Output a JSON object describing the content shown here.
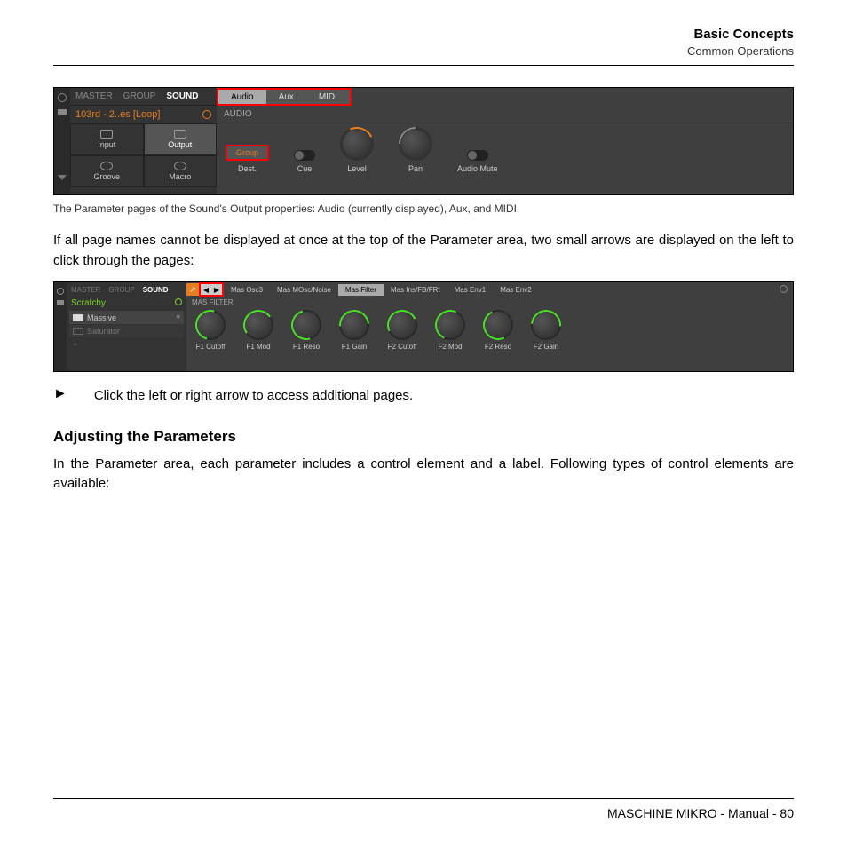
{
  "header": {
    "title": "Basic Concepts",
    "sub": "Common Operations"
  },
  "shot1": {
    "leftTabs": [
      "MASTER",
      "GROUP",
      "SOUND"
    ],
    "soundName": "103rd - 2..es [Loop]",
    "btns": {
      "input": "Input",
      "output": "Output",
      "groove": "Groove",
      "macro": "Macro"
    },
    "pageTabs": [
      "Audio",
      "Aux",
      "MIDI"
    ],
    "audioHeader": "AUDIO",
    "params": {
      "dest": "Dest.",
      "group": "Group",
      "cue": "Cue",
      "level": "Level",
      "pan": "Pan",
      "mute": "Audio Mute"
    }
  },
  "caption1": "The Parameter pages of the Sound's Output properties: Audio (currently displayed), Aux, and MIDI.",
  "para1": "If all page names cannot be displayed at once at the top of the Parameter area, two small arrows are displayed on the left to click through the pages:",
  "shot2": {
    "leftTabs": [
      "MASTER",
      "GROUP",
      "SOUND"
    ],
    "soundName": "Scratchy",
    "items": [
      "Massive",
      "Saturator",
      "+"
    ],
    "pageTabs": [
      "Mas Osc3",
      "Mas MOsc/Noise",
      "Mas Filter",
      "Mas Ins/FB/FRt",
      "Mas Env1",
      "Mas Env2"
    ],
    "sectionHeader": "MAS FILTER",
    "knobs": [
      "F1 Cutoff",
      "F1 Mod",
      "F1 Reso",
      "F1 Gain",
      "F2 Cutoff",
      "F2 Mod",
      "F2 Reso",
      "F2 Gain"
    ]
  },
  "instruct": "Click the left or right arrow to access additional pages.",
  "section": "Adjusting the Parameters",
  "para2": "In the Parameter area, each parameter includes a control element and a label. Following types of control elements are available:",
  "footer": "MASCHINE MIKRO - Manual - 80"
}
